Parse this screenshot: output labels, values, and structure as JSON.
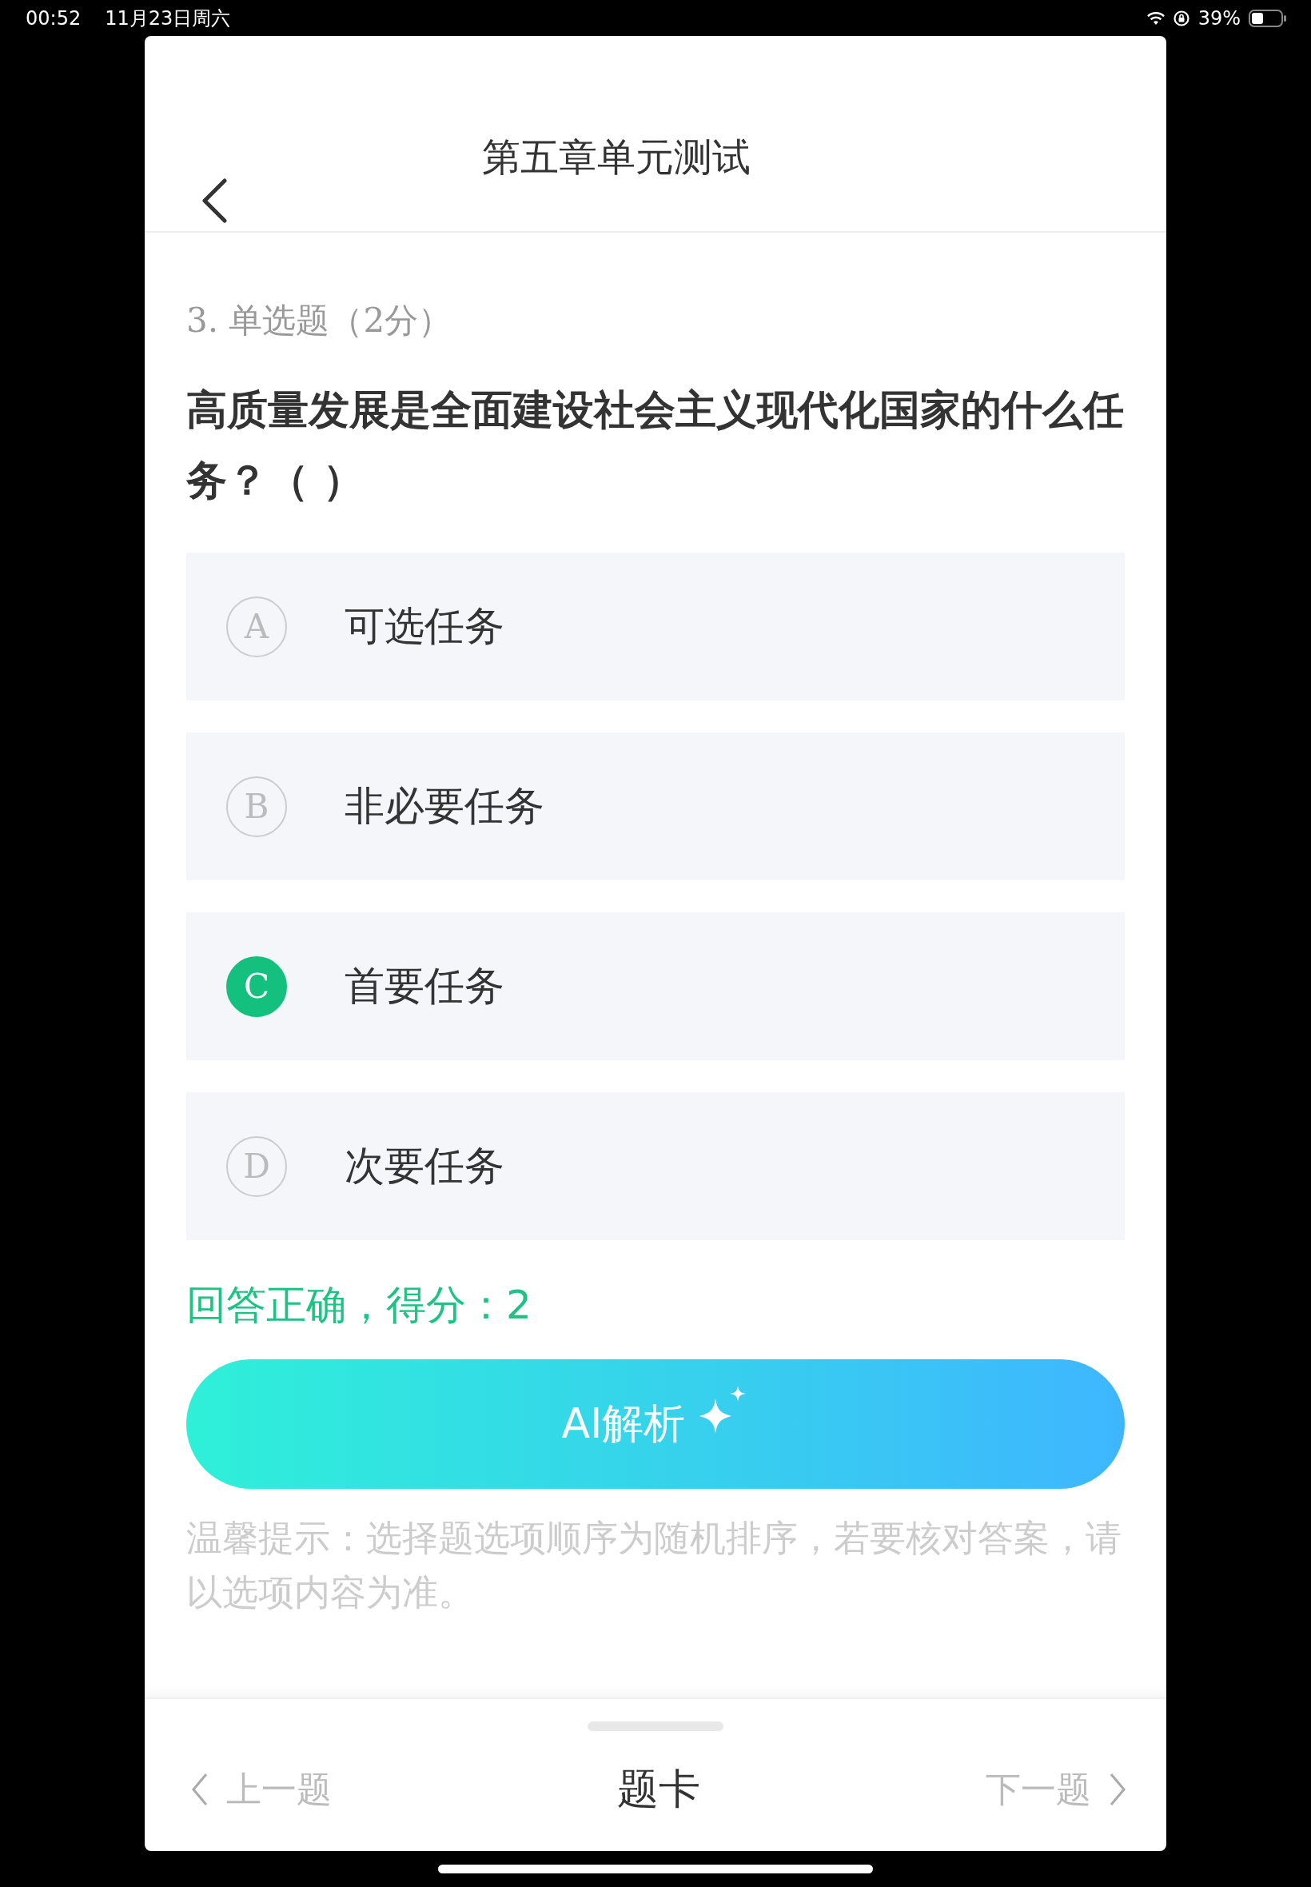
{
  "status_bar": {
    "time": "00:52",
    "date": "11月23日周六",
    "battery": "39%"
  },
  "header": {
    "title": "第五章单元测试"
  },
  "question": {
    "type_label": "3. 单选题（2分）",
    "text": "高质量发展是全面建设社会主义现代化国家的什么任务？（ ）"
  },
  "options": [
    {
      "letter": "A",
      "text": "可选任务",
      "selected": false
    },
    {
      "letter": "B",
      "text": "非必要任务",
      "selected": false
    },
    {
      "letter": "C",
      "text": "首要任务",
      "selected": true
    },
    {
      "letter": "D",
      "text": "次要任务",
      "selected": false
    }
  ],
  "result": {
    "text": "回答正确，得分：2"
  },
  "ai_button": {
    "label": "AI解析"
  },
  "tip": {
    "text": "温馨提示：选择题选项顺序为随机排序，若要核对答案，请以选项内容为准。"
  },
  "footer": {
    "prev": "上一题",
    "card": "题卡",
    "next": "下一题"
  }
}
